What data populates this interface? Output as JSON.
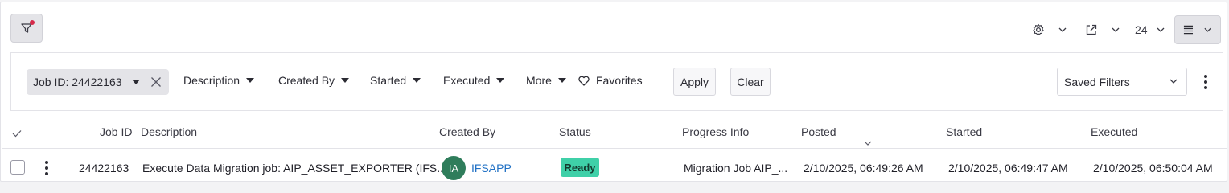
{
  "toolbar": {
    "page_size": "24",
    "icons": {
      "filter": "filter-icon",
      "settings": "gear-icon",
      "export": "export-icon",
      "view": "list-view-icon"
    }
  },
  "filters": {
    "active_chip": "Job ID: 24422163",
    "items": [
      "Description",
      "Created By",
      "Started",
      "Executed",
      "More"
    ],
    "favorites": "Favorites",
    "apply": "Apply",
    "clear": "Clear",
    "saved_filters": "Saved Filters"
  },
  "table": {
    "columns": [
      "Job ID",
      "Description",
      "Created By",
      "Status",
      "Progress Info",
      "Posted",
      "Started",
      "Executed"
    ],
    "sort_column": "Posted",
    "sort_direction": "descending",
    "rows": [
      {
        "job_id": "24422163",
        "description": "Execute Data Migration job: AIP_ASSET_EXPORTER (IFS...",
        "created_by_initials": "IA",
        "created_by": "IFSAPP",
        "status": "Ready",
        "progress_info": "Migration Job AIP_...",
        "posted": "2/10/2025, 06:49:26 AM",
        "started": "2/10/2025, 06:49:47 AM",
        "executed": "2/10/2025, 06:50:04 AM"
      }
    ]
  },
  "colors": {
    "accent_link": "#1e6fc4",
    "status_ready": "#3fd0a8",
    "avatar": "#2f7d5b",
    "filter_dot": "#d62a4a"
  }
}
